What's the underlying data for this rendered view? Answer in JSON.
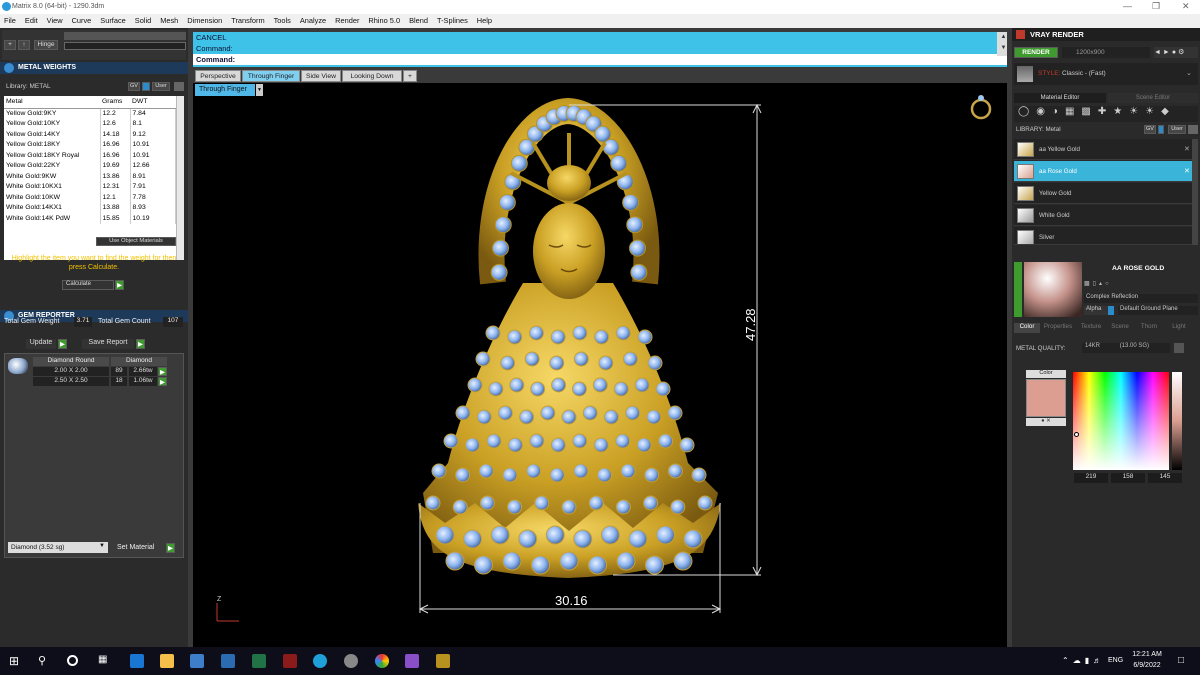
{
  "title": "Matrix 8.0 (64-bit) - 1290.3dm",
  "menu": [
    "File",
    "Edit",
    "View",
    "Curve",
    "Surface",
    "Solid",
    "Mesh",
    "Dimension",
    "Transform",
    "Tools",
    "Analyze",
    "Render",
    "Rhino 5.0",
    "Blend",
    "T-Splines",
    "Help"
  ],
  "toolbar": {
    "hinge_label": "Hinge"
  },
  "metal_weights": {
    "header": "METAL WEIGHTS",
    "library_label": "Library: METAL",
    "gv": "GV",
    "user": "User",
    "columns": [
      "Metal",
      "Grams",
      "DWT"
    ],
    "rows": [
      [
        "Yellow Gold:9KY",
        "12.2",
        "7.84"
      ],
      [
        "Yellow Gold:10KY",
        "12.6",
        "8.1"
      ],
      [
        "Yellow Gold:14KY",
        "14.18",
        "9.12"
      ],
      [
        "Yellow Gold:18KY",
        "16.96",
        "10.91"
      ],
      [
        "Yellow Gold:18KY Royal",
        "16.96",
        "10.91"
      ],
      [
        "Yellow Gold:22KY",
        "19.69",
        "12.66"
      ],
      [
        "White Gold:9KW",
        "13.86",
        "8.91"
      ],
      [
        "White Gold:10KX1",
        "12.31",
        "7.91"
      ],
      [
        "White Gold:10KW",
        "12.1",
        "7.78"
      ],
      [
        "White Gold:14KX1",
        "13.88",
        "8.93"
      ],
      [
        "White Gold:14K PdW",
        "15.85",
        "10.19"
      ]
    ],
    "use_object_materials": "Use Object Materials",
    "hint": "Highlight the item you want to find the weight for then press Calculate.",
    "calculate": "Calculate"
  },
  "gem_reporter": {
    "header": "GEM REPORTER",
    "total_weight_label": "Total Gem Weight",
    "total_weight": "3.71",
    "total_count_label": "Total Gem Count",
    "total_count": "107",
    "update": "Update",
    "save_report": "Save Report",
    "col_shape": "Diamond Round",
    "col_type": "Diamond",
    "rows": [
      [
        "2.00 X 2.00",
        "89",
        "2.66tw"
      ],
      [
        "2.50 X 2.50",
        "18",
        "1.06tw"
      ]
    ],
    "material_select": "Diamond    (3.52 sg)",
    "set_material": "Set Material"
  },
  "command": {
    "line1": "CANCEL",
    "line2": "Command:",
    "line3": "Command:"
  },
  "view_tabs": [
    "Perspective",
    "Through Finger",
    "Side View",
    "Looking Down",
    "+"
  ],
  "active_view": "Through Finger",
  "viewport": {
    "dim_height": "47.28",
    "dim_width": "30.16",
    "axis": "Z"
  },
  "vray": {
    "header": "VRAY RENDER",
    "render": "RENDER",
    "resolution": "1200x900",
    "style_label": "STYLE:",
    "style_value": "Classic - (Fast)",
    "tab_material": "Material Editor",
    "tab_scene": "Scene Editor",
    "library_label": "LIBRARY: Metal",
    "gv": "GV",
    "user": "User",
    "materials": [
      {
        "name": "aa Yellow Gold",
        "color": "#c9a54a"
      },
      {
        "name": "aa Rose Gold",
        "color": "#d9a090"
      },
      {
        "name": "Yellow Gold",
        "color": "#c7a44c"
      },
      {
        "name": "White Gold",
        "color": "#d4d4d4"
      },
      {
        "name": "Silver",
        "color": "#dcdcdc"
      }
    ],
    "selected_material": "aa Rose Gold",
    "selected_title": "AA ROSE GOLD",
    "reflection": "Complex Reflection",
    "alpha": "Alpha",
    "ground_plane": "Default Ground Plane",
    "sub_tabs": [
      "Color",
      "Properties",
      "Texture",
      "Scene",
      "Thorn",
      "Light"
    ],
    "metal_quality_label": "METAL QUALITY:",
    "metal_quality_value": "14KR",
    "metal_quality_hint": "(13.00 SG)",
    "color_label": "Color",
    "swatch_color": "#db9e91",
    "rgb": [
      "219",
      "158",
      "145"
    ]
  },
  "taskbar": {
    "lang": "ENG",
    "time": "12:21 AM",
    "date": "6/9/2022"
  }
}
